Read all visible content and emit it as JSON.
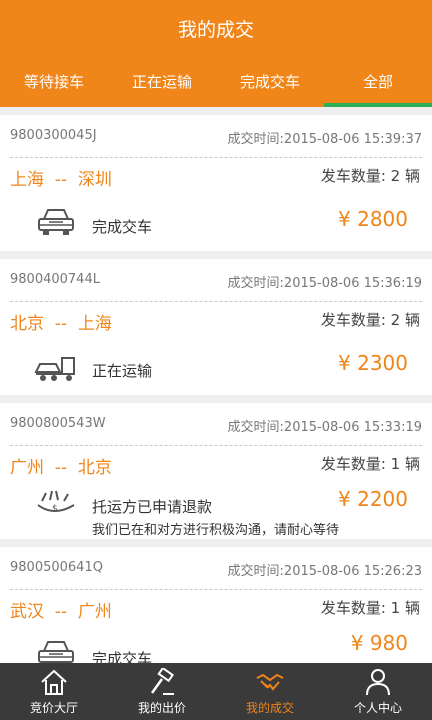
{
  "header": {
    "title": "我的成交"
  },
  "tabs": [
    {
      "label": "等待接车"
    },
    {
      "label": "正在运输"
    },
    {
      "label": "完成交车"
    },
    {
      "label": "全部"
    }
  ],
  "active_tab": "全部",
  "orders": [
    {
      "order_no": "9800300045J",
      "time": "成交时间:2015-08-06 15:39:37",
      "route": "上海  --  深圳",
      "count": "发车数量: 2 辆",
      "status_icon": "car-icon",
      "status": "完成交车",
      "status_sub": "",
      "price": "¥ 2800"
    },
    {
      "order_no": "9800400744L",
      "time": "成交时间:2015-08-06 15:36:19",
      "route": "北京  --  上海",
      "count": "发车数量: 2 辆",
      "status_icon": "truck-icon",
      "status": "正在运输",
      "status_sub": "",
      "price": "¥ 2300"
    },
    {
      "order_no": "9800800543W",
      "time": "成交时间:2015-08-06 15:33:19",
      "route": "广州  --  北京",
      "count": "发车数量: 1 辆",
      "status_icon": "refund-icon",
      "status": "托运方已申请退款",
      "status_sub": "我们已在和对方进行积极沟通，请耐心等待",
      "price": "¥ 2200"
    },
    {
      "order_no": "9800500641Q",
      "time": "成交时间:2015-08-06 15:26:23",
      "route": "武汉  --  广州",
      "count": "发车数量: 1 辆",
      "status_icon": "car-icon",
      "status": "完成交车",
      "status_sub": "",
      "price": "¥ 980"
    }
  ],
  "bottom_nav": [
    {
      "label": "竞价大厅",
      "icon": "home-icon"
    },
    {
      "label": "我的出价",
      "icon": "gavel-icon"
    },
    {
      "label": "我的成交",
      "icon": "handshake-icon"
    },
    {
      "label": "个人中心",
      "icon": "person-icon"
    }
  ],
  "active_nav": "我的成交",
  "colors": {
    "brand_orange": "#f08519",
    "tab_indicator": "#2fae57",
    "nav_bg": "#3a3a3a"
  }
}
